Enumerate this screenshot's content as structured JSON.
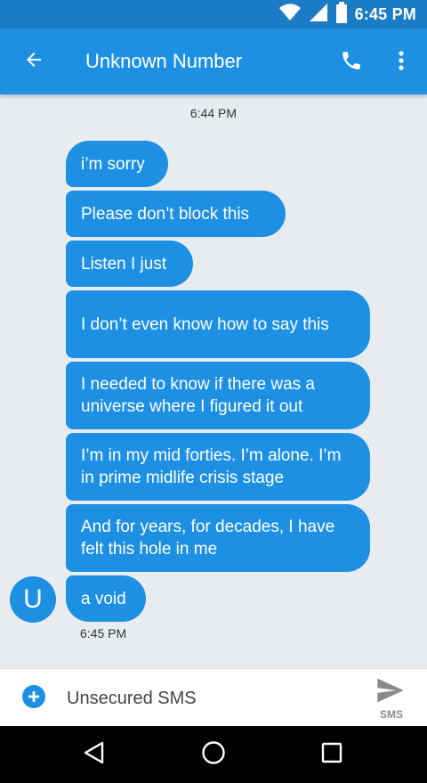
{
  "status_bar": {
    "time": "6:45 PM",
    "icons": [
      "wifi-icon",
      "signal-icon",
      "battery-icon"
    ]
  },
  "app_bar": {
    "title": "Unknown Number",
    "icons": [
      "back-arrow-icon",
      "phone-icon",
      "more-vert-icon"
    ]
  },
  "conversation": {
    "timestamp_start": "6:44 PM",
    "messages": [
      "i’m sorry",
      "Please don’t block this",
      "Listen I just",
      "I don’t even know how to say this",
      "I needed to know if there was a universe where I figured it out",
      "I’m in my mid forties. I’m alone. I’m in prime midlife crisis stage",
      "And for years, for decades, I have felt this hole in me",
      "a void"
    ],
    "avatar_letter": "U",
    "timestamp_end": "6:45 PM"
  },
  "compose": {
    "placeholder": "Unsecured SMS",
    "send_label": "SMS",
    "icons": [
      "add-circle-icon",
      "send-icon"
    ]
  },
  "nav_bar": {
    "icons": [
      "nav-back-icon",
      "nav-home-icon",
      "nav-recents-icon"
    ]
  },
  "colors": {
    "status_bar": "#1b7bc4",
    "app_bar": "#1e90e4",
    "bubble": "#1e90e4",
    "background": "#e9ecef",
    "nav_bar": "#000000"
  }
}
